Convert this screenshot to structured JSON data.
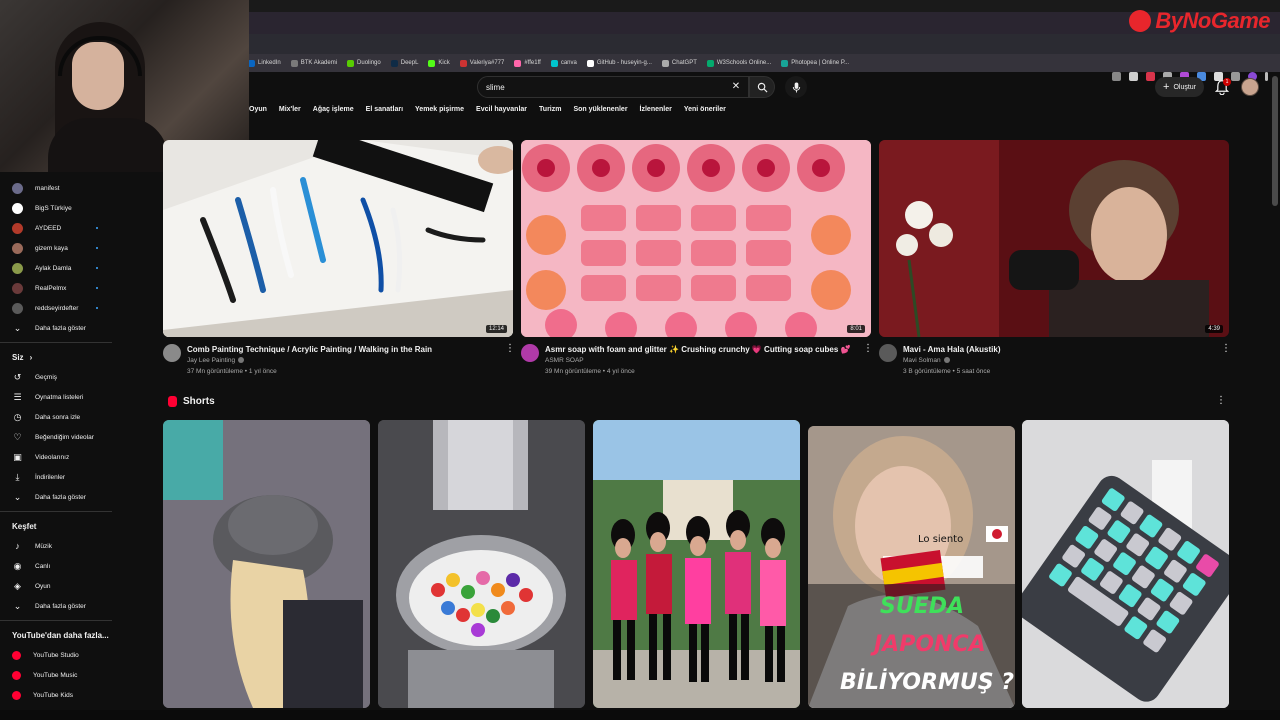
{
  "logo": {
    "text": "ByNoGame"
  },
  "bookmarks": [
    {
      "label": "LinkedIn",
      "color": "#0a66c2"
    },
    {
      "label": "BTK Akademi",
      "color": "#7a7a7a"
    },
    {
      "label": "Duolingo",
      "color": "#58cc02"
    },
    {
      "label": "DeepL",
      "color": "#0f2b46"
    },
    {
      "label": "Kick",
      "color": "#53fc18"
    },
    {
      "label": "Valeriya#777",
      "color": "#cc3333"
    },
    {
      "label": "#ffe1ff",
      "color": "#ff66aa"
    },
    {
      "label": "canva",
      "color": "#00c4cc"
    },
    {
      "label": "GitHub - huseyin-g...",
      "color": "#ffffff"
    },
    {
      "label": "ChatGPT",
      "color": "#aaaaaa"
    },
    {
      "label": "W3Schools Online...",
      "color": "#04aa6d"
    },
    {
      "label": "Photopea | Online P...",
      "color": "#18a497"
    }
  ],
  "header": {
    "search_value": "slime",
    "create_label": "Oluştur",
    "notification_count": "1"
  },
  "chips": [
    "Oyun",
    "Mix'ler",
    "Ağaç işleme",
    "El sanatları",
    "Yemek pişirme",
    "Evcil hayvanlar",
    "Turizm",
    "Son yüklenenler",
    "İzlenenler",
    "Yeni öneriler"
  ],
  "sidebar": {
    "subscriptions": [
      {
        "label": "manifest",
        "color": "#6b6b8a",
        "live": false
      },
      {
        "label": "BigS Türkiye",
        "color": "#ffffff",
        "live": false
      },
      {
        "label": "AYDEED",
        "color": "#b23a2a",
        "live": true
      },
      {
        "label": "gizem kaya",
        "color": "#9a6a5a",
        "live": true
      },
      {
        "label": "Aylak Damla",
        "color": "#8a9a4a",
        "live": true
      },
      {
        "label": "RealPelmx",
        "color": "#6a3a3a",
        "live": true
      },
      {
        "label": "reddseyirdefter",
        "color": "#5a5a5a",
        "live": true
      }
    ],
    "sub_more": "Daha fazla göster",
    "you_header": "Siz",
    "you_items": [
      "Geçmiş",
      "Oynatma listeleri",
      "Daha sonra izle",
      "Beğendiğim videolar",
      "Videolarınız",
      "İndirilenler",
      "Daha fazla göster"
    ],
    "explore_header": "Keşfet",
    "explore_items": [
      "Müzik",
      "Canlı",
      "Oyun",
      "Daha fazla göster"
    ],
    "more_header": "YouTube'dan daha fazla...",
    "more_items": [
      "YouTube Studio",
      "YouTube Music",
      "YouTube Kids"
    ]
  },
  "videos": [
    {
      "title": "Comb Painting Technique / Acrylic Painting / Walking in the Rain",
      "channel": "Jay Lee Painting",
      "stats": "37 Mn görüntüleme • 1 yıl önce",
      "duration": "12:14"
    },
    {
      "title": "Asmr soap with foam and glitter ✨ Crushing crunchy 💗 Cutting soap cubes 💕",
      "channel": "ASMR SOAP",
      "stats": "39 Mn görüntüleme • 4 yıl önce",
      "duration": "8:01"
    },
    {
      "title": "Mavi - Ama Hala (Akustik)",
      "channel": "Mavi Solman",
      "stats": "3 B görüntüleme • 5 saat önce",
      "duration": "4:39"
    }
  ],
  "shorts": {
    "title": "Shorts",
    "overlay_lo_siento": "Lo siento",
    "overlay_sueda": "SUEDA",
    "overlay_japonca": "JAPONCA",
    "overlay_biliyormus": "BİLİYORMUŞ ?"
  }
}
